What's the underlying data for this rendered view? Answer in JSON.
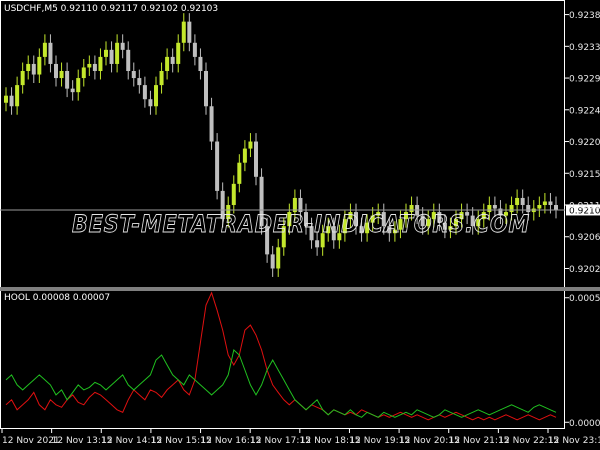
{
  "main_chart": {
    "title": "USDCHF,M5  0.92110 0.92117 0.92102 0.92103",
    "price_ticks": [
      "0.92380",
      "0.92335",
      "0.92290",
      "0.92245",
      "0.92200",
      "0.92155",
      "0.92110",
      "0.92065",
      "0.92020"
    ],
    "current_price": "0.92103",
    "bull_color": "#c4e82c",
    "bear_color": "#bfbfbf"
  },
  "watermark": "BEST-METATRADER-INDICATORS.COM",
  "indicator": {
    "title": "HOOL 0.00008 0.00007",
    "ticks": [
      "0.00053",
      "0.00003"
    ],
    "line1_color": "#e01010",
    "line2_color": "#20c020"
  },
  "time_axis": {
    "labels": [
      "12 Nov 2021",
      "12 Nov 13:15",
      "12 Nov 14:15",
      "12 Nov 15:15",
      "12 Nov 16:15",
      "12 Nov 17:15",
      "12 Nov 18:15",
      "12 Nov 19:15",
      "12 Nov 20:15",
      "12 Nov 21:15",
      "12 Nov 22:15",
      "12 Nov 23:15"
    ]
  },
  "chart_data": {
    "type": "candlestick",
    "symbol": "USDCHF",
    "timeframe": "M5",
    "closes": [
      0.92265,
      0.9225,
      0.9228,
      0.923,
      0.9231,
      0.92295,
      0.9232,
      0.9234,
      0.9231,
      0.9229,
      0.923,
      0.92275,
      0.9227,
      0.9229,
      0.92305,
      0.9231,
      0.923,
      0.9232,
      0.9233,
      0.9231,
      0.9234,
      0.9233,
      0.923,
      0.9229,
      0.9228,
      0.9226,
      0.9225,
      0.9228,
      0.923,
      0.9232,
      0.9231,
      0.9234,
      0.9237,
      0.9234,
      0.9232,
      0.923,
      0.9225,
      0.922,
      0.9213,
      0.9209,
      0.9211,
      0.9214,
      0.9217,
      0.9219,
      0.922,
      0.9215,
      0.9208,
      0.9204,
      0.9202,
      0.9205,
      0.9208,
      0.921,
      0.9212,
      0.921,
      0.9208,
      0.9206,
      0.9205,
      0.9207,
      0.9208,
      0.9206,
      0.9207,
      0.9209,
      0.921,
      0.9208,
      0.9207,
      0.92085,
      0.92095,
      0.921,
      0.9208,
      0.9207,
      0.92075,
      0.9209,
      0.921,
      0.9211,
      0.92095,
      0.9208,
      0.9209,
      0.921,
      0.92085,
      0.92075,
      0.9208,
      0.9209,
      0.921,
      0.92095,
      0.9208,
      0.9209,
      0.921,
      0.9211,
      0.92105,
      0.92095,
      0.921,
      0.9211,
      0.9212,
      0.9211,
      0.921,
      0.92105,
      0.9211,
      0.92115,
      0.9211,
      0.92103
    ],
    "indicator_series": [
      {
        "values": [
          0.0001,
          0.00012,
          8e-05,
          0.0001,
          0.00012,
          0.00015,
          0.0001,
          8e-05,
          0.00012,
          0.0001,
          9e-05,
          0.00012,
          0.00014,
          0.00011,
          0.0001,
          0.00013,
          0.00015,
          0.00014,
          0.00012,
          0.0001,
          8e-05,
          7e-05,
          0.00012,
          0.00016,
          0.00014,
          0.00012,
          0.00016,
          0.00015,
          0.00013,
          0.00016,
          0.00018,
          0.0002,
          0.00016,
          0.00014,
          0.0002,
          0.00035,
          0.0005,
          0.00055,
          0.00048,
          0.0004,
          0.0003,
          0.00026,
          0.0003,
          0.0004,
          0.00042,
          0.00038,
          0.00032,
          0.00024,
          0.00018,
          0.00015,
          0.00012,
          0.0001,
          0.00012,
          0.0001,
          8e-05,
          0.0001,
          9e-05,
          8e-05,
          6e-05,
          8e-05,
          7e-05,
          6e-05,
          7e-05,
          6e-05,
          8e-05,
          7e-05,
          6e-05,
          5e-05,
          6e-05,
          5e-05,
          6e-05,
          7e-05,
          6e-05,
          5e-05,
          6e-05,
          5e-05,
          4e-05,
          5e-05,
          6e-05,
          5e-05,
          6e-05,
          7e-05,
          6e-05,
          5e-05,
          4e-05,
          5e-05,
          4e-05,
          5e-05,
          4e-05,
          5e-05,
          6e-05,
          5e-05,
          4e-05,
          5e-05,
          6e-05,
          5e-05,
          4e-05,
          5e-05,
          6e-05,
          5e-05
        ]
      },
      {
        "values": [
          0.0002,
          0.00022,
          0.00018,
          0.00016,
          0.00018,
          0.0002,
          0.00022,
          0.0002,
          0.00018,
          0.00014,
          0.00016,
          0.00012,
          0.00015,
          0.00018,
          0.00016,
          0.00017,
          0.00019,
          0.00018,
          0.00016,
          0.00018,
          0.0002,
          0.00022,
          0.00018,
          0.00016,
          0.00018,
          0.0002,
          0.00022,
          0.00028,
          0.0003,
          0.00026,
          0.00022,
          0.0002,
          0.00018,
          0.00022,
          0.0002,
          0.00018,
          0.00016,
          0.00014,
          0.00016,
          0.00018,
          0.00022,
          0.00032,
          0.0003,
          0.00024,
          0.00018,
          0.00014,
          0.00018,
          0.00024,
          0.00028,
          0.00024,
          0.0002,
          0.00016,
          0.00012,
          0.0001,
          8e-05,
          0.0001,
          0.00012,
          8e-05,
          6e-05,
          8e-05,
          7e-05,
          6e-05,
          8e-05,
          6e-05,
          5e-05,
          7e-05,
          6e-05,
          5e-05,
          7e-05,
          6e-05,
          5e-05,
          6e-05,
          7e-05,
          6e-05,
          8e-05,
          7e-05,
          6e-05,
          5e-05,
          6e-05,
          8e-05,
          7e-05,
          6e-05,
          5e-05,
          6e-05,
          7e-05,
          8e-05,
          7e-05,
          6e-05,
          7e-05,
          8e-05,
          9e-05,
          0.0001,
          9e-05,
          8e-05,
          7e-05,
          9e-05,
          0.0001,
          9e-05,
          8e-05,
          7e-05
        ]
      }
    ]
  }
}
